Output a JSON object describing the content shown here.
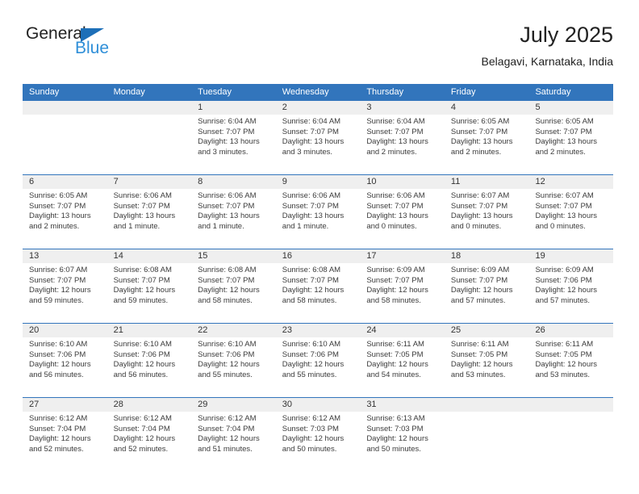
{
  "brand": {
    "name_part1": "General",
    "name_part2": "Blue",
    "accent_color": "#2f8fd8",
    "triangle_color": "#1d6fb8"
  },
  "header": {
    "title": "July 2025",
    "location": "Belagavi, Karnataka, India"
  },
  "calendar": {
    "header_bg": "#3275bc",
    "daynum_band_bg": "#efefef",
    "weekdays": [
      "Sunday",
      "Monday",
      "Tuesday",
      "Wednesday",
      "Thursday",
      "Friday",
      "Saturday"
    ],
    "weeks": [
      [
        {
          "day": "",
          "empty": true
        },
        {
          "day": "",
          "empty": true
        },
        {
          "day": "1",
          "sunrise": "Sunrise: 6:04 AM",
          "sunset": "Sunset: 7:07 PM",
          "daylight1": "Daylight: 13 hours",
          "daylight2": "and 3 minutes."
        },
        {
          "day": "2",
          "sunrise": "Sunrise: 6:04 AM",
          "sunset": "Sunset: 7:07 PM",
          "daylight1": "Daylight: 13 hours",
          "daylight2": "and 3 minutes."
        },
        {
          "day": "3",
          "sunrise": "Sunrise: 6:04 AM",
          "sunset": "Sunset: 7:07 PM",
          "daylight1": "Daylight: 13 hours",
          "daylight2": "and 2 minutes."
        },
        {
          "day": "4",
          "sunrise": "Sunrise: 6:05 AM",
          "sunset": "Sunset: 7:07 PM",
          "daylight1": "Daylight: 13 hours",
          "daylight2": "and 2 minutes."
        },
        {
          "day": "5",
          "sunrise": "Sunrise: 6:05 AM",
          "sunset": "Sunset: 7:07 PM",
          "daylight1": "Daylight: 13 hours",
          "daylight2": "and 2 minutes."
        }
      ],
      [
        {
          "day": "6",
          "sunrise": "Sunrise: 6:05 AM",
          "sunset": "Sunset: 7:07 PM",
          "daylight1": "Daylight: 13 hours",
          "daylight2": "and 2 minutes."
        },
        {
          "day": "7",
          "sunrise": "Sunrise: 6:06 AM",
          "sunset": "Sunset: 7:07 PM",
          "daylight1": "Daylight: 13 hours",
          "daylight2": "and 1 minute."
        },
        {
          "day": "8",
          "sunrise": "Sunrise: 6:06 AM",
          "sunset": "Sunset: 7:07 PM",
          "daylight1": "Daylight: 13 hours",
          "daylight2": "and 1 minute."
        },
        {
          "day": "9",
          "sunrise": "Sunrise: 6:06 AM",
          "sunset": "Sunset: 7:07 PM",
          "daylight1": "Daylight: 13 hours",
          "daylight2": "and 1 minute."
        },
        {
          "day": "10",
          "sunrise": "Sunrise: 6:06 AM",
          "sunset": "Sunset: 7:07 PM",
          "daylight1": "Daylight: 13 hours",
          "daylight2": "and 0 minutes."
        },
        {
          "day": "11",
          "sunrise": "Sunrise: 6:07 AM",
          "sunset": "Sunset: 7:07 PM",
          "daylight1": "Daylight: 13 hours",
          "daylight2": "and 0 minutes."
        },
        {
          "day": "12",
          "sunrise": "Sunrise: 6:07 AM",
          "sunset": "Sunset: 7:07 PM",
          "daylight1": "Daylight: 13 hours",
          "daylight2": "and 0 minutes."
        }
      ],
      [
        {
          "day": "13",
          "sunrise": "Sunrise: 6:07 AM",
          "sunset": "Sunset: 7:07 PM",
          "daylight1": "Daylight: 12 hours",
          "daylight2": "and 59 minutes."
        },
        {
          "day": "14",
          "sunrise": "Sunrise: 6:08 AM",
          "sunset": "Sunset: 7:07 PM",
          "daylight1": "Daylight: 12 hours",
          "daylight2": "and 59 minutes."
        },
        {
          "day": "15",
          "sunrise": "Sunrise: 6:08 AM",
          "sunset": "Sunset: 7:07 PM",
          "daylight1": "Daylight: 12 hours",
          "daylight2": "and 58 minutes."
        },
        {
          "day": "16",
          "sunrise": "Sunrise: 6:08 AM",
          "sunset": "Sunset: 7:07 PM",
          "daylight1": "Daylight: 12 hours",
          "daylight2": "and 58 minutes."
        },
        {
          "day": "17",
          "sunrise": "Sunrise: 6:09 AM",
          "sunset": "Sunset: 7:07 PM",
          "daylight1": "Daylight: 12 hours",
          "daylight2": "and 58 minutes."
        },
        {
          "day": "18",
          "sunrise": "Sunrise: 6:09 AM",
          "sunset": "Sunset: 7:07 PM",
          "daylight1": "Daylight: 12 hours",
          "daylight2": "and 57 minutes."
        },
        {
          "day": "19",
          "sunrise": "Sunrise: 6:09 AM",
          "sunset": "Sunset: 7:06 PM",
          "daylight1": "Daylight: 12 hours",
          "daylight2": "and 57 minutes."
        }
      ],
      [
        {
          "day": "20",
          "sunrise": "Sunrise: 6:10 AM",
          "sunset": "Sunset: 7:06 PM",
          "daylight1": "Daylight: 12 hours",
          "daylight2": "and 56 minutes."
        },
        {
          "day": "21",
          "sunrise": "Sunrise: 6:10 AM",
          "sunset": "Sunset: 7:06 PM",
          "daylight1": "Daylight: 12 hours",
          "daylight2": "and 56 minutes."
        },
        {
          "day": "22",
          "sunrise": "Sunrise: 6:10 AM",
          "sunset": "Sunset: 7:06 PM",
          "daylight1": "Daylight: 12 hours",
          "daylight2": "and 55 minutes."
        },
        {
          "day": "23",
          "sunrise": "Sunrise: 6:10 AM",
          "sunset": "Sunset: 7:06 PM",
          "daylight1": "Daylight: 12 hours",
          "daylight2": "and 55 minutes."
        },
        {
          "day": "24",
          "sunrise": "Sunrise: 6:11 AM",
          "sunset": "Sunset: 7:05 PM",
          "daylight1": "Daylight: 12 hours",
          "daylight2": "and 54 minutes."
        },
        {
          "day": "25",
          "sunrise": "Sunrise: 6:11 AM",
          "sunset": "Sunset: 7:05 PM",
          "daylight1": "Daylight: 12 hours",
          "daylight2": "and 53 minutes."
        },
        {
          "day": "26",
          "sunrise": "Sunrise: 6:11 AM",
          "sunset": "Sunset: 7:05 PM",
          "daylight1": "Daylight: 12 hours",
          "daylight2": "and 53 minutes."
        }
      ],
      [
        {
          "day": "27",
          "sunrise": "Sunrise: 6:12 AM",
          "sunset": "Sunset: 7:04 PM",
          "daylight1": "Daylight: 12 hours",
          "daylight2": "and 52 minutes."
        },
        {
          "day": "28",
          "sunrise": "Sunrise: 6:12 AM",
          "sunset": "Sunset: 7:04 PM",
          "daylight1": "Daylight: 12 hours",
          "daylight2": "and 52 minutes."
        },
        {
          "day": "29",
          "sunrise": "Sunrise: 6:12 AM",
          "sunset": "Sunset: 7:04 PM",
          "daylight1": "Daylight: 12 hours",
          "daylight2": "and 51 minutes."
        },
        {
          "day": "30",
          "sunrise": "Sunrise: 6:12 AM",
          "sunset": "Sunset: 7:03 PM",
          "daylight1": "Daylight: 12 hours",
          "daylight2": "and 50 minutes."
        },
        {
          "day": "31",
          "sunrise": "Sunrise: 6:13 AM",
          "sunset": "Sunset: 7:03 PM",
          "daylight1": "Daylight: 12 hours",
          "daylight2": "and 50 minutes."
        },
        {
          "day": "",
          "empty": true
        },
        {
          "day": "",
          "empty": true
        }
      ]
    ]
  }
}
